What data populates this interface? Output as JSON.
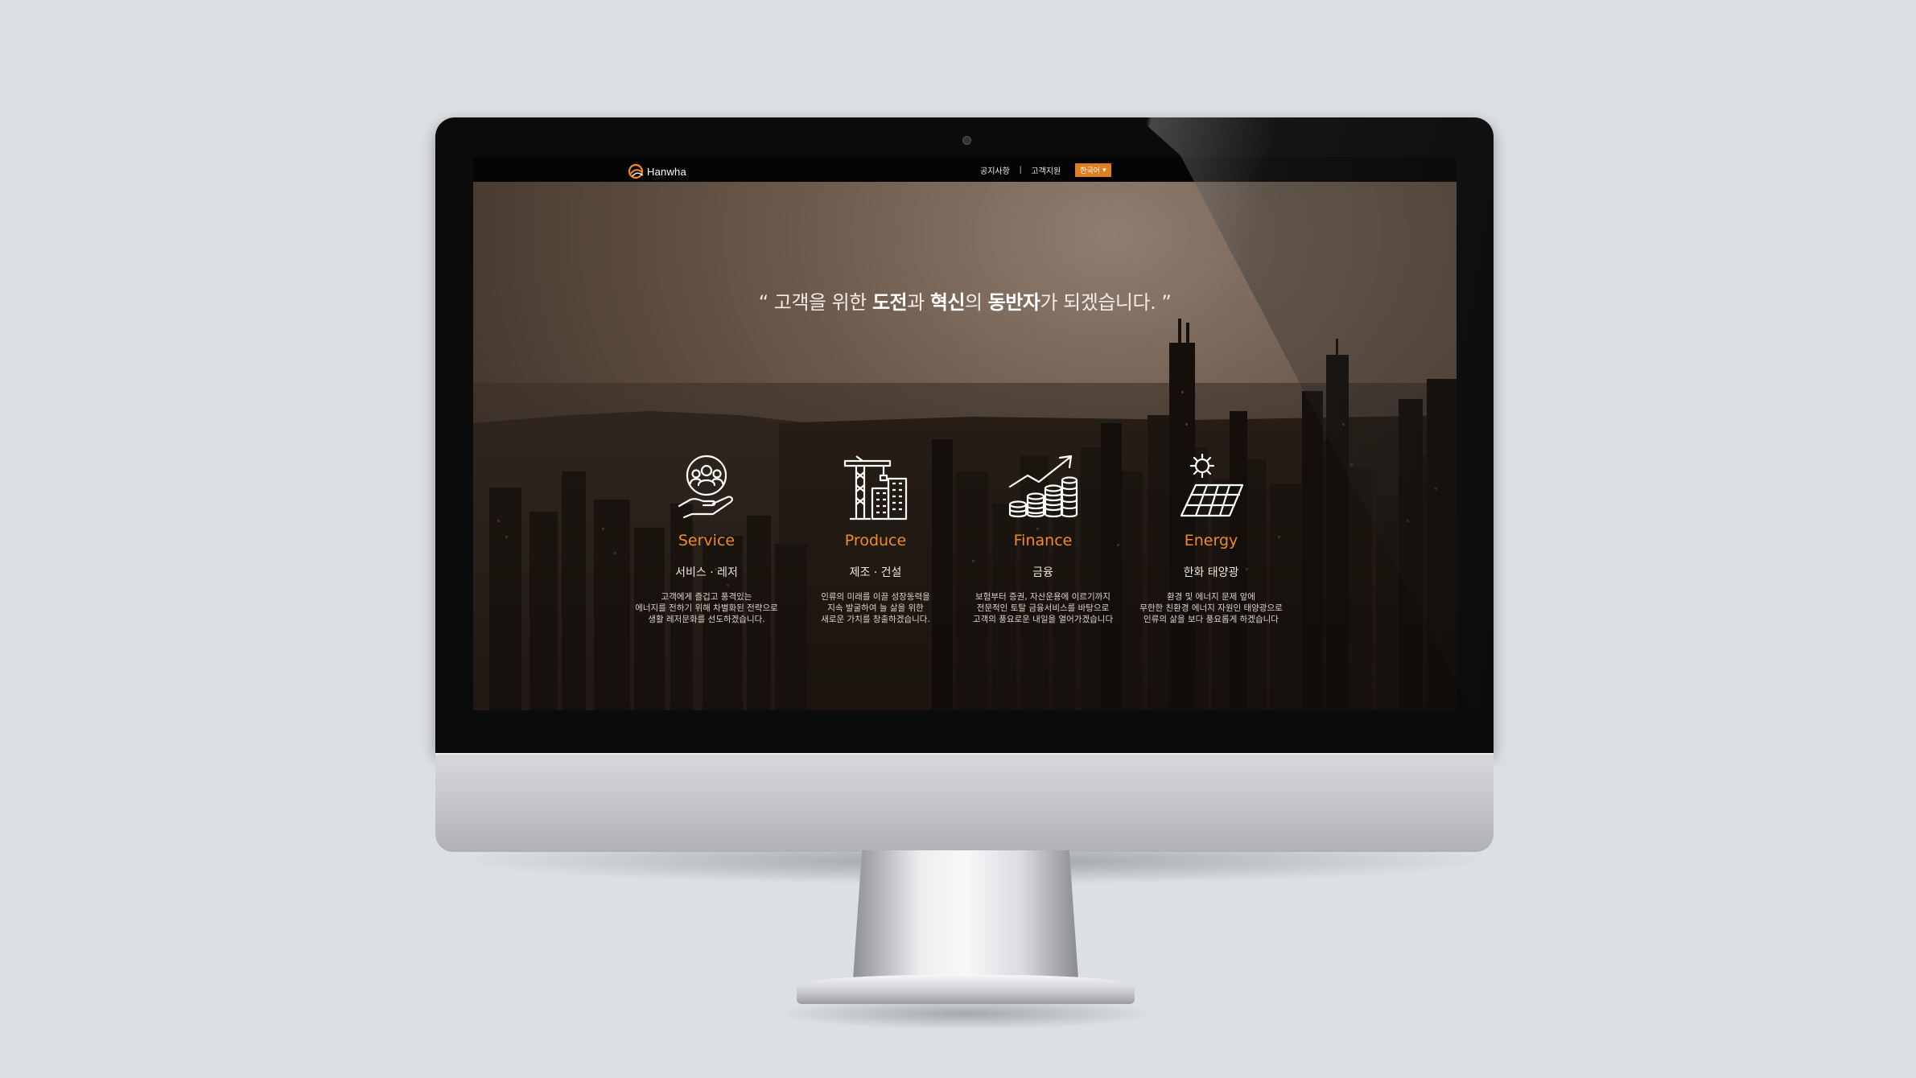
{
  "header": {
    "logo_text": "Hanwha",
    "nav": [
      {
        "label": "공지사항"
      },
      {
        "label": "고객지원"
      }
    ],
    "separator": "|",
    "language": {
      "label": "한국어",
      "caret": "▾"
    }
  },
  "hero": {
    "tagline_parts": [
      {
        "text": "“ 고객을 위한 ",
        "bold": false
      },
      {
        "text": "도전",
        "bold": true
      },
      {
        "text": "과 ",
        "bold": false
      },
      {
        "text": "혁신",
        "bold": true
      },
      {
        "text": "의 ",
        "bold": false
      },
      {
        "text": "동반자",
        "bold": true
      },
      {
        "text": "가 되겠습니다. ”",
        "bold": false
      }
    ]
  },
  "features": [
    {
      "icon": "hand-people-icon",
      "title": "Service",
      "subtitle": "서비스 · 레저",
      "description": "고객에게 즐겁고 풍격있는\n에너지를 전하기 위해 차별화된 전략으로\n생활 레저문화를 선도하겠습니다."
    },
    {
      "icon": "crane-building-icon",
      "title": "Produce",
      "subtitle": "제조 · 건설",
      "description": "인류의 미래를 이끌 성장동력을\n지속 발굴하여 늘 삶을 위한\n새로운 가치를 창출하겠습니다."
    },
    {
      "icon": "coins-growth-icon",
      "title": "Finance",
      "subtitle": "금융",
      "description": "보험부터 증권, 자산운용에 이르기까지\n전문적인 토탈 금융서비스를 바탕으로\n고객의 풍요로운 내일을 열어가겠습니다"
    },
    {
      "icon": "solar-panel-icon",
      "title": "Energy",
      "subtitle": "한화 태양광",
      "description": "환경 및 에너지 문제 앞에\n무한한 친환경 에너지 자원인 태양광으로\n인류의 삶을 보다 풍요롭게 하겠습니다"
    }
  ],
  "colors": {
    "accent": "#f08a26",
    "lang_button": "#e07e22",
    "background": "#dde0e3",
    "topbar": "#050505"
  }
}
